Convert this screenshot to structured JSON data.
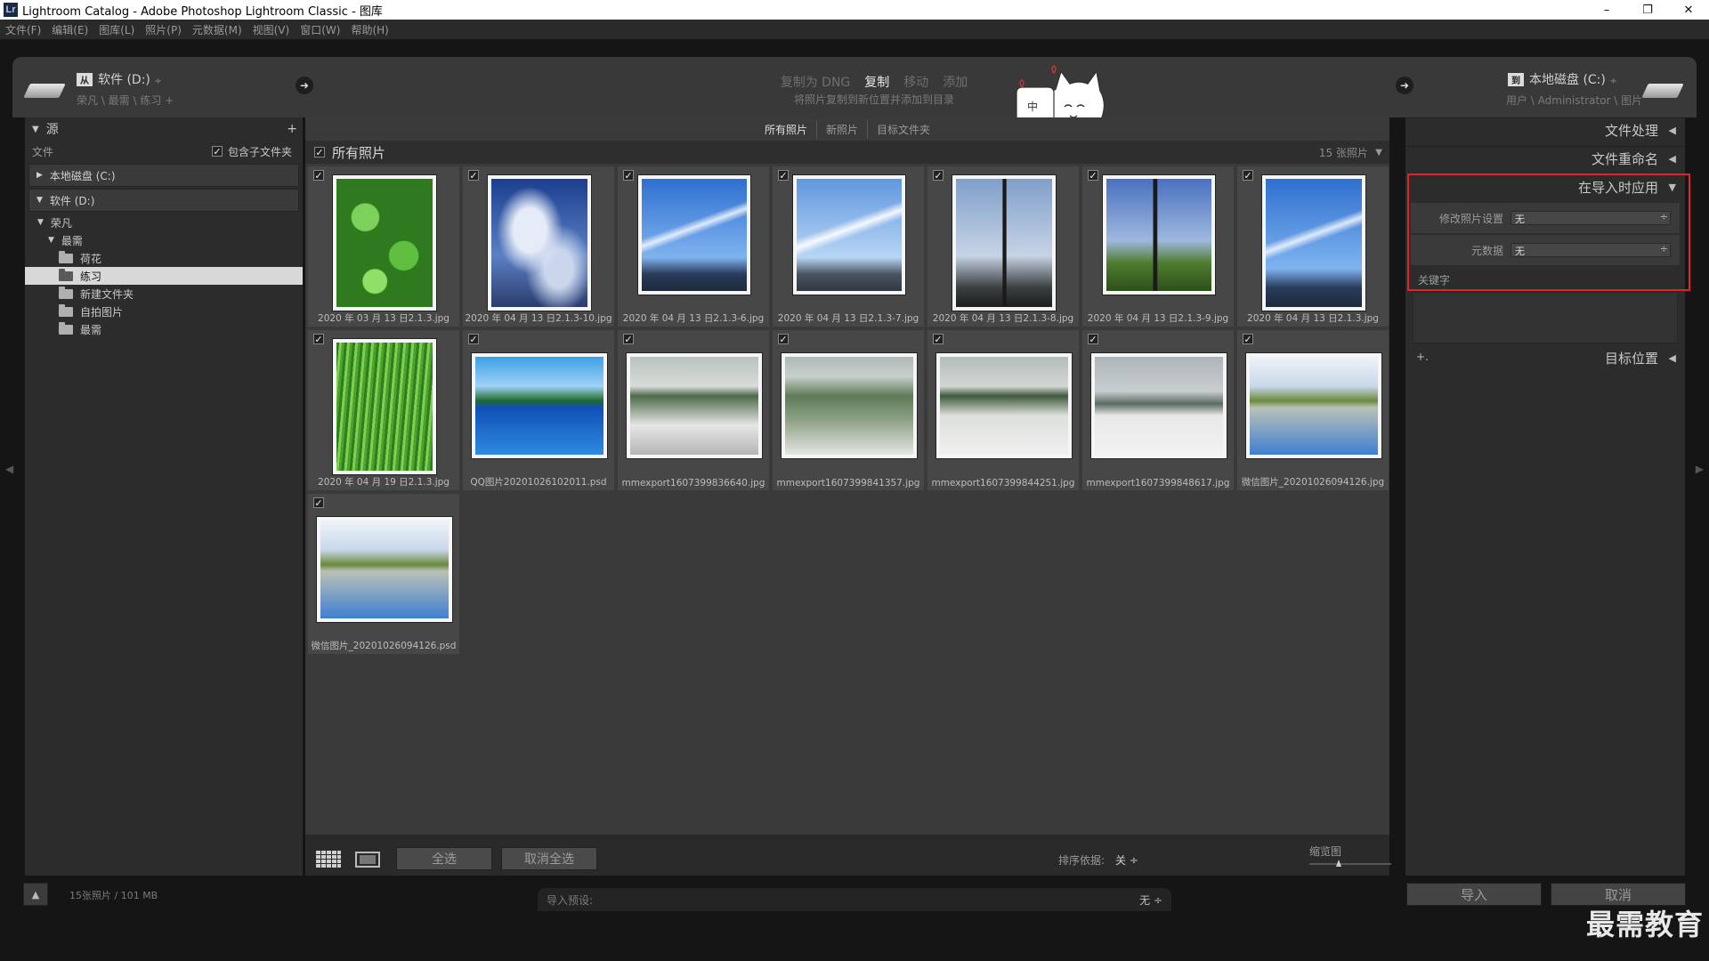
{
  "window": {
    "title": "Lightroom Catalog - Adobe Photoshop Lightroom Classic - 图库",
    "app_icon": "Lr",
    "minimize": "–",
    "maximize": "❐",
    "close": "✕"
  },
  "menu": [
    "文件(F)",
    "编辑(E)",
    "图库(L)",
    "照片(P)",
    "元数据(M)",
    "视图(V)",
    "窗口(W)",
    "帮助(H)"
  ],
  "header": {
    "source_badge": "从",
    "source_drive": "软件 (D:)",
    "source_path": "荣凡 \\ 最需 \\ 练习 +",
    "modes": [
      "复制为 DNG",
      "复制",
      "移动",
      "添加"
    ],
    "active_mode": "复制",
    "mode_description": "将照片复制到新位置并添加到目录",
    "dest_badge": "到",
    "dest_drive": "本地磁盘 (C:)",
    "dest_path": "用户 \\ Administrator \\ 图片",
    "sticker_text": "中"
  },
  "left_panel": {
    "title": "源",
    "files_label": "文件",
    "include_subfolders": "包含子文件夹",
    "volume_c": "本地磁盘 (C:)",
    "volume_d": "软件 (D:)",
    "tree": [
      {
        "label": "荣凡",
        "indent": 0,
        "expanded": true
      },
      {
        "label": "最需",
        "indent": 1,
        "expanded": true
      },
      {
        "label": "荷花",
        "indent": 2
      },
      {
        "label": "练习",
        "indent": 2,
        "selected": true
      },
      {
        "label": "新建文件夹",
        "indent": 2
      },
      {
        "label": "自拍图片",
        "indent": 2
      },
      {
        "label": "最需",
        "indent": 2
      }
    ]
  },
  "center": {
    "filter_tabs": [
      "所有照片",
      "新照片",
      "目标文件夹"
    ],
    "active_tab": "所有照片",
    "grid_title": "所有照片",
    "photo_count": "15 张照片",
    "photos": [
      {
        "name": "2020 年 03 月 13 日2.1.3.jpg",
        "kind": "green-leaves",
        "orient": "portrait"
      },
      {
        "name": "2020 年 04 月 13 日2.1.3-10.jpg",
        "kind": "clouds",
        "orient": "portrait"
      },
      {
        "name": "2020 年 04 月 13 日2.1.3-6.jpg",
        "kind": "sky-tree",
        "orient": "landscape-sq"
      },
      {
        "name": "2020 年 04 月 13 日2.1.3-7.jpg",
        "kind": "sky-pale",
        "orient": "landscape-sq"
      },
      {
        "name": "2020 年 04 月 13 日2.1.3-8.jpg",
        "kind": "poles",
        "orient": "portrait"
      },
      {
        "name": "2020 年 04 月 13 日2.1.3-9.jpg",
        "kind": "poles-green",
        "orient": "landscape-sq"
      },
      {
        "name": "2020 年 04 月 13 日2.1.3.jpg",
        "kind": "sky-tree",
        "orient": "portrait"
      },
      {
        "name": "2020 年 04 月 19 日2.1.3.jpg",
        "kind": "willow",
        "orient": "portrait"
      },
      {
        "name": "QQ图片20201026102011.psd",
        "kind": "lake-blue",
        "orient": "landscape"
      },
      {
        "name": "mmexport1607399836640.jpg",
        "kind": "snow-bridge",
        "orient": "landscape"
      },
      {
        "name": "mmexport1607399841357.jpg",
        "kind": "snow-trees",
        "orient": "landscape"
      },
      {
        "name": "mmexport1607399844251.jpg",
        "kind": "snow-field",
        "orient": "landscape"
      },
      {
        "name": "mmexport1607399848617.jpg",
        "kind": "snow-city",
        "orient": "landscape"
      },
      {
        "name": "微信图片_20201026094126.jpg",
        "kind": "lake-autumn",
        "orient": "landscape"
      },
      {
        "name": "微信图片_20201026094126.psd",
        "kind": "lake-autumn",
        "orient": "landscape"
      }
    ],
    "select_all": "全选",
    "deselect_all": "取消全选",
    "sort_label": "排序依据:",
    "sort_value": "关 ÷",
    "thumb_label": "缩览图"
  },
  "right_panel": {
    "file_handling": "文件处理",
    "file_renaming": "文件重命名",
    "apply_during_import": "在导入时应用",
    "develop_settings_label": "修改照片设置",
    "develop_settings_value": "无",
    "metadata_label": "元数据",
    "metadata_value": "无",
    "keywords_label": "关键字",
    "destination": "目标位置",
    "plus": "+."
  },
  "bottom": {
    "stats": "15张照片 / 101 MB",
    "preset_label": "导入预设:",
    "preset_value": "无 ÷",
    "import": "导入",
    "cancel": "取消",
    "watermark": "最需教育"
  },
  "colors": {
    "highlight_box": "#e0232b",
    "panel_bg": "#2c2c2c",
    "grid_bg": "#3a3a3a"
  }
}
